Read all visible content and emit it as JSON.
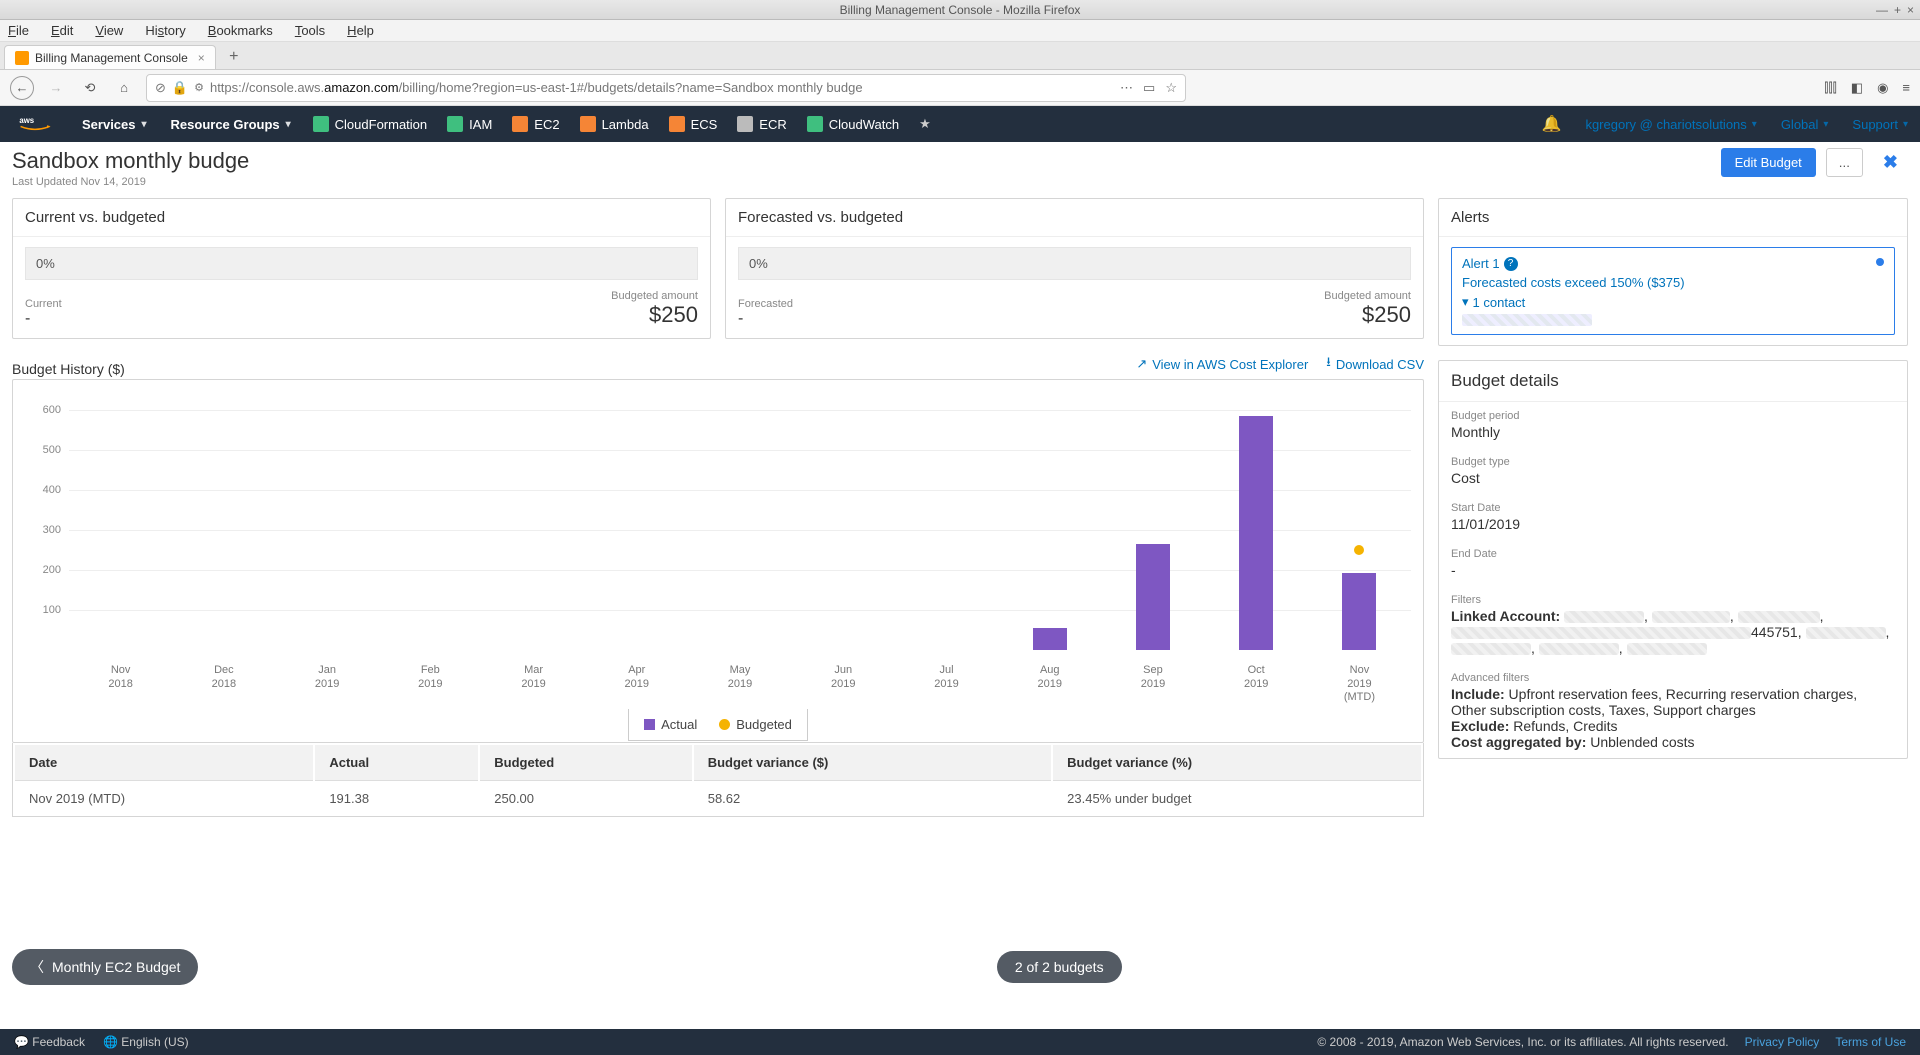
{
  "window": {
    "title": "Billing Management Console - Mozilla Firefox"
  },
  "browser": {
    "menus": [
      "File",
      "Edit",
      "View",
      "History",
      "Bookmarks",
      "Tools",
      "Help"
    ],
    "tab_title": "Billing Management Console",
    "url_prefix": "https://console.aws.",
    "url_domain": "amazon.com",
    "url_suffix": "/billing/home?region=us-east-1#/budgets/details?name=Sandbox monthly budge"
  },
  "aws_nav": {
    "services": "Services",
    "resource_groups": "Resource Groups",
    "shortcuts": [
      {
        "name": "CloudFormation",
        "color": "#3fbf7f"
      },
      {
        "name": "IAM",
        "color": "#3fbf7f"
      },
      {
        "name": "EC2",
        "color": "#f58536"
      },
      {
        "name": "Lambda",
        "color": "#f58536"
      },
      {
        "name": "ECS",
        "color": "#f58536"
      },
      {
        "name": "ECR",
        "color": "#bbb"
      },
      {
        "name": "CloudWatch",
        "color": "#3fbf7f"
      }
    ],
    "user": "kgregory @ chariotsolutions",
    "region": "Global",
    "support": "Support"
  },
  "header": {
    "title": "Sandbox monthly budge",
    "subtitle": "Last Updated Nov 14, 2019",
    "edit": "Edit Budget",
    "more": "..."
  },
  "current_panel": {
    "title": "Current vs. budgeted",
    "percent": "0%",
    "left_label": "Current",
    "left_val": "-",
    "right_label": "Budgeted amount",
    "right_val": "$250"
  },
  "forecast_panel": {
    "title": "Forecasted vs. budgeted",
    "percent": "0%",
    "left_label": "Forecasted",
    "left_val": "-",
    "right_label": "Budgeted amount",
    "right_val": "$250"
  },
  "history": {
    "title": "Budget History ($)",
    "link_explorer": "View in AWS Cost Explorer",
    "link_csv": "Download CSV",
    "legend_actual": "Actual",
    "legend_budgeted": "Budgeted"
  },
  "table": {
    "cols": [
      "Date",
      "Actual",
      "Budgeted",
      "Budget variance ($)",
      "Budget variance (%)"
    ],
    "row": [
      "Nov 2019 (MTD)",
      "191.38",
      "250.00",
      "58.62",
      "23.45% under budget"
    ]
  },
  "alerts": {
    "title": "Alerts",
    "name": "Alert 1",
    "desc": "Forecasted costs exceed 150% ($375)",
    "contact": "1 contact"
  },
  "details": {
    "title": "Budget details",
    "period_l": "Budget period",
    "period_v": "Monthly",
    "type_l": "Budget type",
    "type_v": "Cost",
    "start_l": "Start Date",
    "start_v": "11/01/2019",
    "end_l": "End Date",
    "end_v": "-",
    "filters_l": "Filters",
    "linked": "Linked Account:",
    "linked_tail": "445751,",
    "adv_l": "Advanced filters",
    "include_l": "Include:",
    "include_v": " Upfront reservation fees, Recurring reservation charges, Other subscription costs, Taxes, Support charges",
    "exclude_l": "Exclude:",
    "exclude_v": " Refunds, Credits",
    "agg_l": "Cost aggregated by:",
    "agg_v": " Unblended costs"
  },
  "pager": {
    "prev": "Monthly EC2 Budget",
    "count": "2 of 2 budgets"
  },
  "footer": {
    "feedback": "Feedback",
    "lang": "English (US)",
    "copy": "© 2008 - 2019, Amazon Web Services, Inc. or its affiliates. All rights reserved.",
    "privacy": "Privacy Policy",
    "terms": "Terms of Use"
  },
  "chart_data": {
    "type": "bar",
    "title": "Budget History ($)",
    "ylabel": "$",
    "ylim": [
      0,
      650
    ],
    "y_ticks": [
      100,
      200,
      300,
      400,
      500,
      600
    ],
    "categories": [
      "Nov 2018",
      "Dec 2018",
      "Jan 2019",
      "Feb 2019",
      "Mar 2019",
      "Apr 2019",
      "May 2019",
      "Jun 2019",
      "Jul 2019",
      "Aug 2019",
      "Sep 2019",
      "Oct 2019",
      "Nov 2019 (MTD)"
    ],
    "series": [
      {
        "name": "Actual",
        "type": "bar",
        "values": [
          0,
          0,
          0,
          0,
          0,
          0,
          0,
          0,
          0,
          55,
          265,
          585,
          192
        ]
      },
      {
        "name": "Budgeted",
        "type": "scatter",
        "values": [
          null,
          null,
          null,
          null,
          null,
          null,
          null,
          null,
          null,
          null,
          null,
          null,
          250
        ]
      }
    ]
  }
}
